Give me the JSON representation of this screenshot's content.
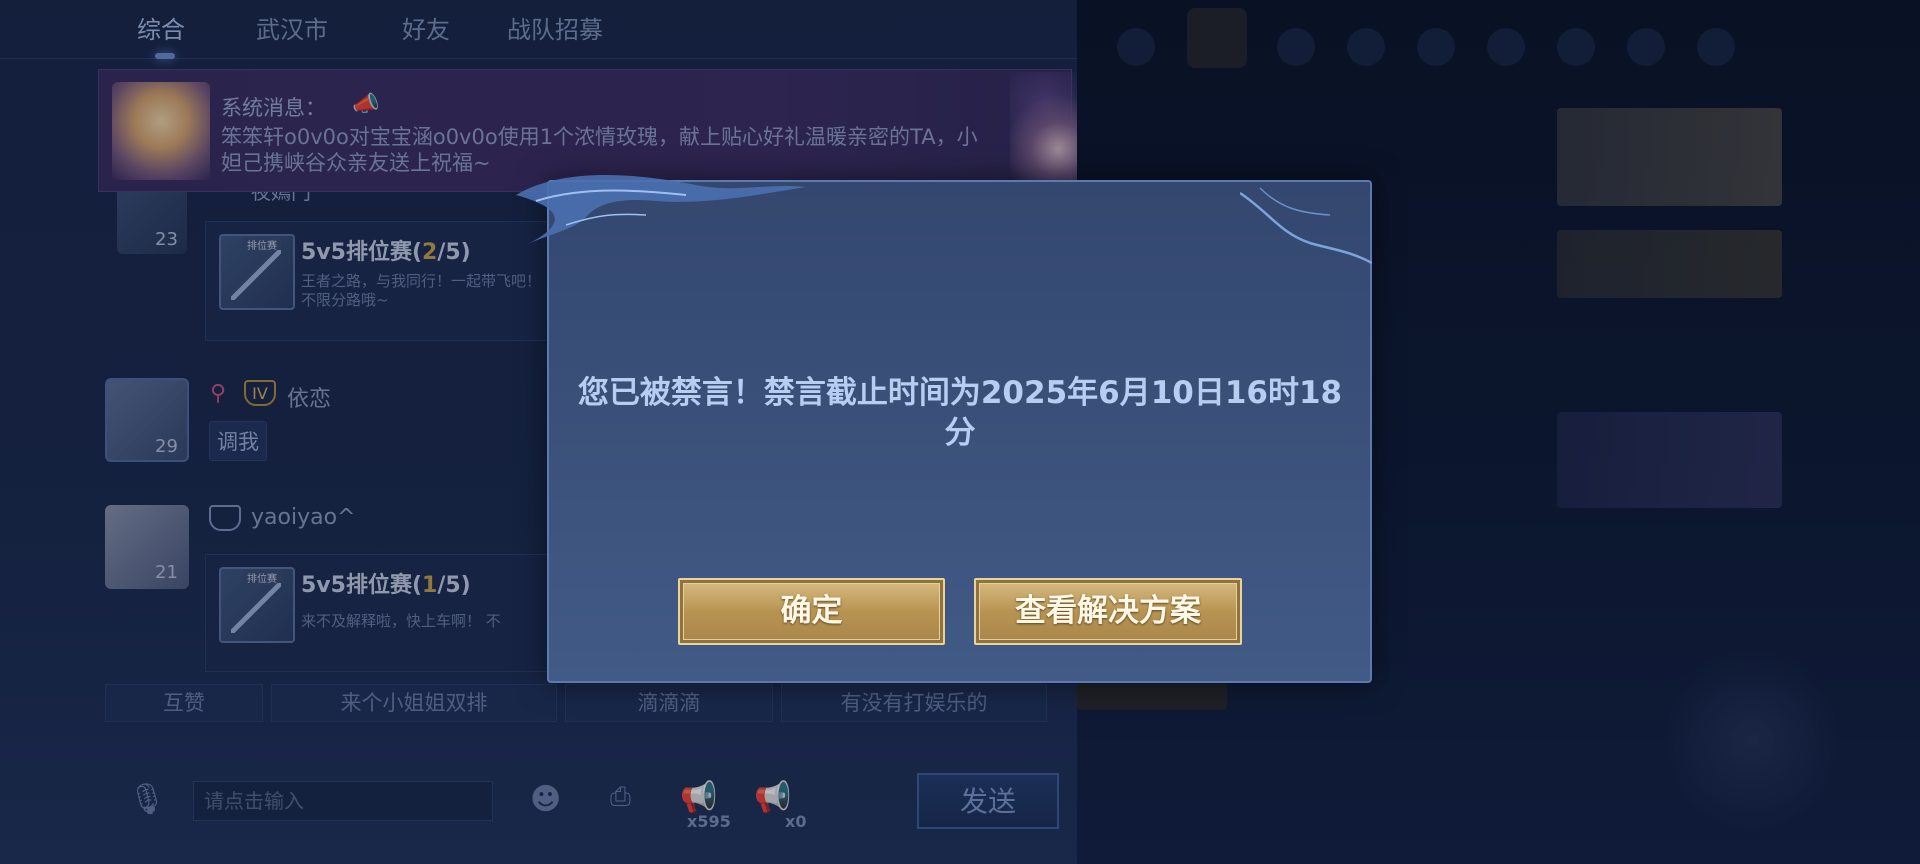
{
  "tabs": [
    "综合",
    "武汉市",
    "好友",
    "战队招募"
  ],
  "system_message": {
    "title": "系统消息：",
    "text": "笨笨轩o0v0o对宝宝涵o0v0o使用1个浓情玫瑰，献上贴心好礼温暖亲密的TA，小妲己携峡谷众亲友送上祝福~"
  },
  "messages": [
    {
      "username": "夜嫣门",
      "level": "23",
      "card": {
        "tag": "排位赛",
        "title_prefix": "5v5排位赛(",
        "current": "2",
        "title_suffix": "/5)",
        "desc": "王者之路，与我同行！一起带飞吧！",
        "desc2": "不限分路哦~"
      }
    },
    {
      "username": "依恋",
      "level": "29",
      "rank_badge": "IV",
      "bubble": "调我"
    },
    {
      "username": "yaoiyao^",
      "level": "21",
      "card": {
        "tag": "排位赛",
        "title_prefix": "5v5排位赛(",
        "current": "1",
        "title_suffix": "/5)",
        "desc": "来不及解释啦，快上车啊！ 不"
      }
    }
  ],
  "quick_replies": [
    "互赞",
    "来个小姐姐双排",
    "滴滴滴",
    "有没有打娱乐的"
  ],
  "input": {
    "placeholder": "请点击输入",
    "horn_count_1": "x595",
    "horn_count_2": "x0",
    "send_label": "发送"
  },
  "icons": {
    "voice": "voice-to-text-icon",
    "emoji": "emoji-icon",
    "gift": "gift-icon",
    "horn": "horn-icon",
    "horn_small": "small-horn-icon"
  },
  "dialog": {
    "message": "您已被禁言！禁言截止时间为2025年6月10日16时18分",
    "confirm_label": "确定",
    "solution_label": "查看解决方案"
  },
  "colors": {
    "panel_bg": "#1b2a4d",
    "dialog_bg": "#3a5079",
    "gold": "#b89453",
    "accent_orange": "#c9a24e"
  }
}
